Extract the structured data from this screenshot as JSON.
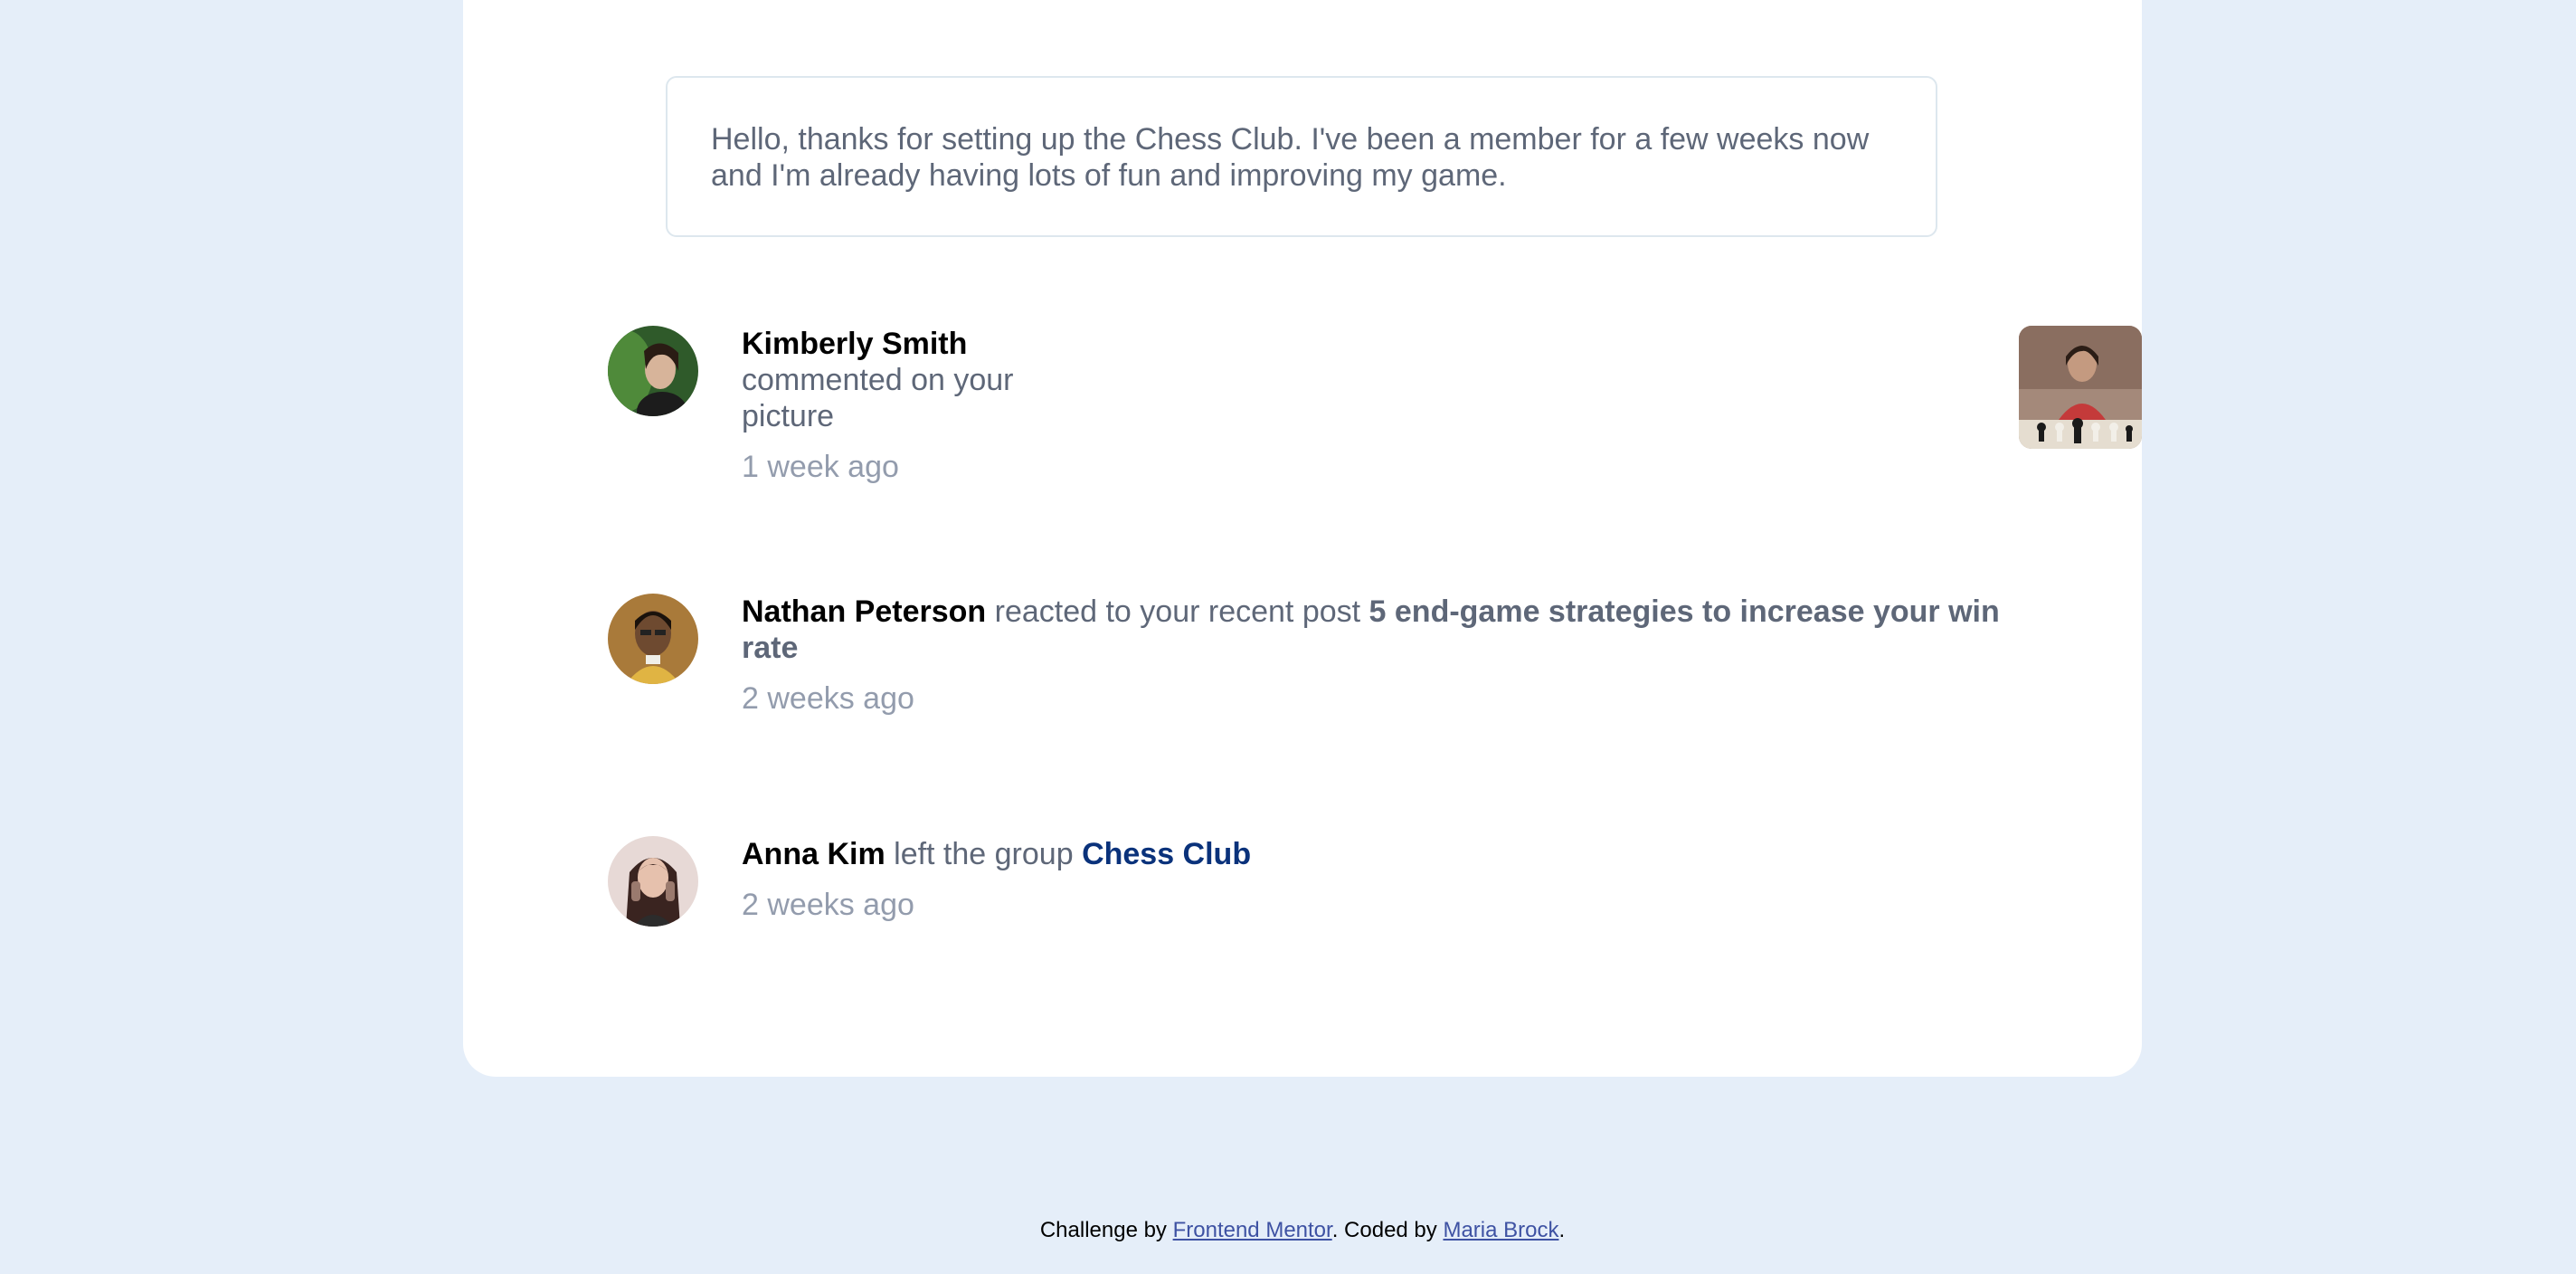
{
  "message": {
    "text": "Hello, thanks for setting up the Chess Club. I've been a member for a few weeks now and I'm already having lots of fun and improving my game."
  },
  "notifications": [
    {
      "name": "Kimberly Smith",
      "action_line1": "commented on your",
      "action_line2": "picture",
      "time": "1 week ago",
      "avatar_icon": "avatar-kimberly-smith",
      "thumbnail_icon": "chess-picture-thumbnail"
    },
    {
      "name": "Nathan Peterson",
      "action": " reacted to your recent post ",
      "post_line1": "5 end-game strategies to increase your win",
      "post_line2": "rate",
      "time": "2 weeks ago",
      "avatar_icon": "avatar-nathan-peterson"
    },
    {
      "name": "Anna Kim",
      "action": " left the group ",
      "group": "Chess Club",
      "time": "2 weeks ago",
      "avatar_icon": "avatar-anna-kim"
    }
  ],
  "attribution": {
    "prefix": "Challenge by ",
    "link1": "Frontend Mentor",
    "middle": ". Coded by ",
    "link2": "Maria Brock",
    "suffix": "."
  },
  "colors": {
    "page_background": "#e5eef9",
    "card_background": "#ffffff",
    "name_text": "#000000",
    "body_text": "#5e6778",
    "time_text": "#939cad",
    "group_link": "#0a327b",
    "attribution_link": "#3e52a3"
  }
}
